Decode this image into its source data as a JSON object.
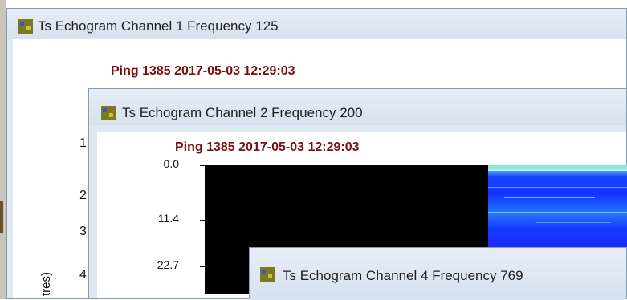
{
  "windows": {
    "ch1": {
      "title": "Ts Echogram Channel 1 Frequency 125",
      "ping": "Ping 1385 2017-05-03 12:29:03",
      "partial_ticks": [
        "1",
        "2",
        "3",
        "4"
      ],
      "partial_ylabel": "tres)"
    },
    "ch2": {
      "title": "Ts Echogram Channel 2 Frequency 200",
      "ping": "Ping 1385 2017-05-03 12:29:03",
      "yticks": [
        "0.0",
        "11.4",
        "22.7"
      ]
    },
    "ch4": {
      "title": "Ts Echogram Channel 4 Frequency 769"
    }
  },
  "icons": {
    "window_icon": "echogram-app-icon"
  },
  "colors": {
    "ping_text": "#7a1010",
    "echo_background": "#000000",
    "echo_signal": "#1a46ff"
  }
}
